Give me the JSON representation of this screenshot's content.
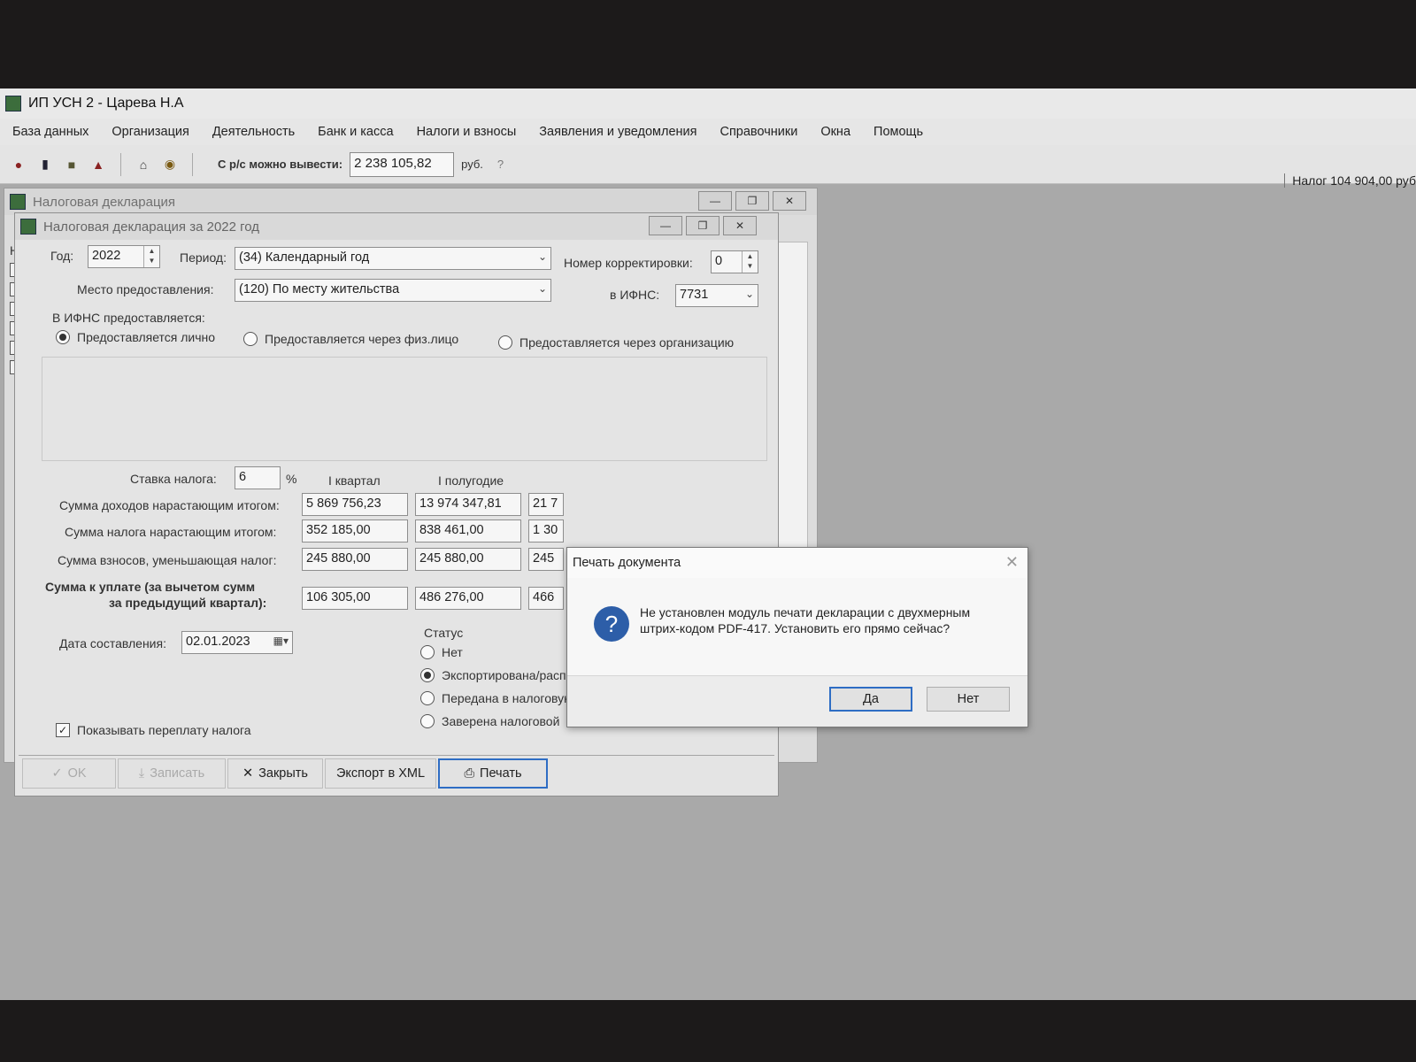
{
  "app": {
    "title": "ИП УСН 2 - Царева Н.А",
    "menu": [
      "База данных",
      "Организация",
      "Деятельность",
      "Банк и касса",
      "Налоги и взносы",
      "Заявления и уведомления",
      "Справочники",
      "Окна",
      "Помощь"
    ],
    "toolbar": {
      "withdraw_label": "С р/с можно вывести:",
      "withdraw_value": "2 238 105,82",
      "currency": "руб.",
      "help": "?"
    },
    "tax_right": "Налог 104 904,00 руб"
  },
  "outer_window": {
    "title": "Налоговая декларация",
    "left_strip_letter": "Н"
  },
  "declaration": {
    "title": "Налоговая декларация за 2022 год",
    "year_label": "Год:",
    "year_value": "2022",
    "period_label": "Период:",
    "period_value": "(34) Календарный год",
    "correction_label": "Номер корректировки:",
    "correction_value": "0",
    "place_label": "Место предоставления:",
    "place_value": "(120) По месту жительства",
    "ifns_label": "в ИФНС:",
    "ifns_value": "7731",
    "provision_header": "В ИФНС предоставляется:",
    "provision_options": [
      {
        "label": "Предоставляется лично",
        "selected": true
      },
      {
        "label": "Предоставляется через физ.лицо",
        "selected": false
      },
      {
        "label": "Предоставляется через организацию",
        "selected": false
      }
    ],
    "rate_label": "Ставка налога:",
    "rate_value": "6",
    "rate_unit": "%",
    "columns": [
      "I квартал",
      "I полугодие"
    ],
    "rows": [
      {
        "label": "Сумма доходов нарастающим итогом:",
        "values": [
          "5 869 756,23",
          "13 974 347,81",
          "21 7"
        ]
      },
      {
        "label": "Сумма налога нарастающим итогом:",
        "values": [
          "352 185,00",
          "838 461,00",
          "1 30"
        ]
      },
      {
        "label": "Сумма взносов, уменьшающая налог:",
        "values": [
          "245 880,00",
          "245 880,00",
          "245"
        ]
      }
    ],
    "payment_label_line1": "Сумма к уплате (за вычетом сумм",
    "payment_label_line2": "за предыдущий квартал):",
    "payment_values": [
      "106 305,00",
      "486 276,00",
      "466"
    ],
    "date_label": "Дата составления:",
    "date_value": "02.01.2023",
    "status_header": "Статус",
    "status_options": [
      {
        "label": "Нет",
        "selected": false
      },
      {
        "label": "Экспортирована/распечатана и подписана",
        "selected": true
      },
      {
        "label": "Передана в налоговую",
        "selected": false
      },
      {
        "label": "Заверена налоговой",
        "selected": false
      }
    ],
    "show_overpay_label": "Показывать переплату налога",
    "show_overpay_checked": true,
    "buttons": {
      "ok": "OK",
      "save": "Записать",
      "close": "Закрыть",
      "export_xml": "Экспорт в XML",
      "print": "Печать"
    }
  },
  "dialog": {
    "title": "Печать документа",
    "message": "Не установлен модуль печати декларации с двухмерным штрих-кодом PDF-417. Установить его прямо сейчас?",
    "yes": "Да",
    "no": "Нет"
  }
}
